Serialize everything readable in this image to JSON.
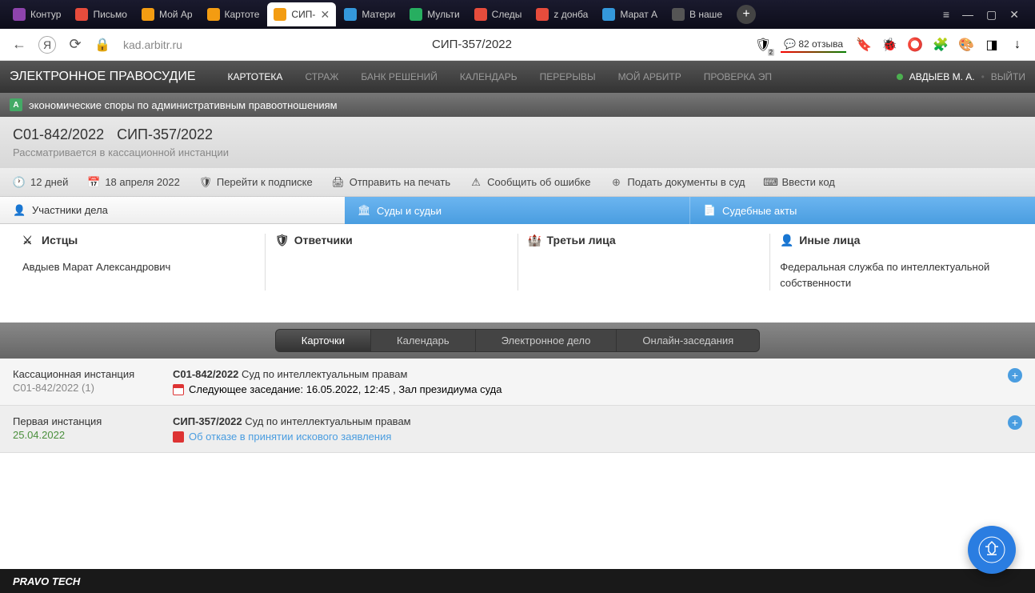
{
  "browser": {
    "tabs": [
      {
        "label": "Контур",
        "color": "#8e44ad"
      },
      {
        "label": "Письмо",
        "color": "#e74c3c"
      },
      {
        "label": "Мой Ар",
        "color": "#f39c12"
      },
      {
        "label": "Картоте",
        "color": "#f39c12"
      },
      {
        "label": "СИП-",
        "color": "#f39c12",
        "active": true
      },
      {
        "label": "Матери",
        "color": "#3498db"
      },
      {
        "label": "Мульти",
        "color": "#27ae60"
      },
      {
        "label": "Следы",
        "color": "#e74c3c"
      },
      {
        "label": "z донба",
        "color": "#e74c3c"
      },
      {
        "label": "Марат А",
        "color": "#3498db"
      },
      {
        "label": "В наше",
        "color": "#555"
      }
    ],
    "url": "kad.arbitr.ru",
    "page_title": "СИП-357/2022",
    "reviews": "82 отзыва",
    "badge_count": "2"
  },
  "top_nav": {
    "title": "ЭЛЕКТРОННОЕ ПРАВОСУДИЕ",
    "items": [
      "КАРТОТЕКА",
      "СТРАЖ",
      "БАНК РЕШЕНИЙ",
      "КАЛЕНДАРЬ",
      "ПЕРЕРЫВЫ",
      "МОЙ АРБИТР",
      "ПРОВЕРКА ЭП"
    ],
    "active_index": 0,
    "user": "АВДЫЕВ М. А.",
    "exit": "ВЫЙТИ"
  },
  "category": {
    "text": "экономические споры по административным правоотношениям"
  },
  "case": {
    "numbers": [
      "С01-842/2022",
      "СИП-357/2022"
    ],
    "status": "Рассматривается в кассационной инстанции"
  },
  "toolbar": {
    "days": "12 дней",
    "date": "18 апреля 2022",
    "subscribe": "Перейти к подписке",
    "print": "Отправить на печать",
    "report": "Сообщить об ошибке",
    "submit": "Подать документы в суд",
    "code": "Ввести код"
  },
  "content_tabs": {
    "participants": "Участники дела",
    "courts": "Суды и судьи",
    "acts": "Судебные акты"
  },
  "participants": {
    "plaintiffs": {
      "title": "Истцы",
      "content": "Авдыев Марат Александрович"
    },
    "defendants": {
      "title": "Ответчики",
      "content": ""
    },
    "third": {
      "title": "Третьи лица",
      "content": ""
    },
    "other": {
      "title": "Иные лица",
      "content": "Федеральная служба по интеллектуальной собственности"
    }
  },
  "view_tabs": [
    "Карточки",
    "Календарь",
    "Электронное дело",
    "Онлайн-заседания"
  ],
  "view_active_index": 0,
  "rows": [
    {
      "left_title": "Кассационная инстанция",
      "left_sub": "С01-842/2022 (1)",
      "left_sub_green": false,
      "case_no": "С01-842/2022",
      "court": "Суд по интеллектуальным правам",
      "detail": "Следующее заседание: 16.05.2022, 12:45 , Зал президиума суда",
      "is_pdf": false
    },
    {
      "left_title": "Первая инстанция",
      "left_sub": "25.04.2022",
      "left_sub_green": true,
      "case_no": "СИП-357/2022",
      "court": "Суд по интеллектуальным правам",
      "detail": "Об отказе в принятии искового заявления",
      "is_pdf": true
    }
  ],
  "footer": "PRAVO TECH"
}
